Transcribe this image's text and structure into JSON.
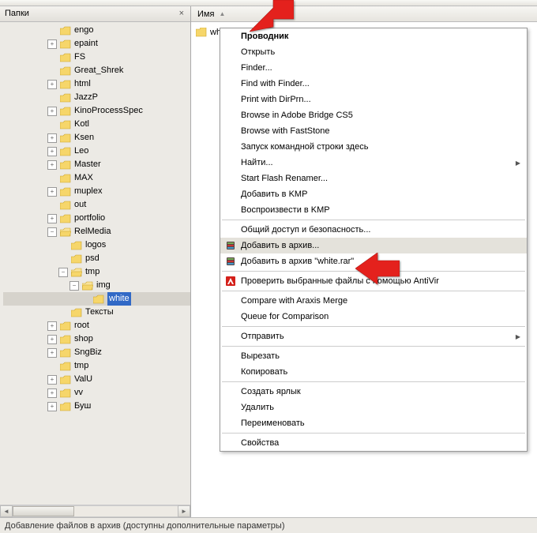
{
  "panel": {
    "title": "Папки"
  },
  "tree": {
    "items": [
      {
        "indent": 2,
        "expander": "",
        "label": "engo"
      },
      {
        "indent": 2,
        "expander": "+",
        "label": "epaint"
      },
      {
        "indent": 2,
        "expander": "",
        "label": "FS"
      },
      {
        "indent": 2,
        "expander": "",
        "label": "Great_Shrek"
      },
      {
        "indent": 2,
        "expander": "+",
        "label": "html"
      },
      {
        "indent": 2,
        "expander": "",
        "label": "JazzP"
      },
      {
        "indent": 2,
        "expander": "+",
        "label": "KinoProcessSpec"
      },
      {
        "indent": 2,
        "expander": "",
        "label": "Kotl"
      },
      {
        "indent": 2,
        "expander": "+",
        "label": "Ksen"
      },
      {
        "indent": 2,
        "expander": "+",
        "label": "Leo"
      },
      {
        "indent": 2,
        "expander": "+",
        "label": "Master"
      },
      {
        "indent": 2,
        "expander": "",
        "label": "MAX"
      },
      {
        "indent": 2,
        "expander": "+",
        "label": "muplex"
      },
      {
        "indent": 2,
        "expander": "",
        "label": "out"
      },
      {
        "indent": 2,
        "expander": "+",
        "label": "portfolio"
      },
      {
        "indent": 2,
        "expander": "-",
        "label": "RelMedia",
        "open": true
      },
      {
        "indent": 3,
        "expander": "",
        "label": "logos"
      },
      {
        "indent": 3,
        "expander": "",
        "label": "psd"
      },
      {
        "indent": 3,
        "expander": "-",
        "label": "tmp",
        "open": true
      },
      {
        "indent": 4,
        "expander": "-",
        "label": "img",
        "open": true
      },
      {
        "indent": 5,
        "expander": "",
        "label": "white",
        "selected": true
      },
      {
        "indent": 3,
        "expander": "",
        "label": "Тексты"
      },
      {
        "indent": 2,
        "expander": "+",
        "label": "root"
      },
      {
        "indent": 2,
        "expander": "+",
        "label": "shop"
      },
      {
        "indent": 2,
        "expander": "+",
        "label": "SngBiz"
      },
      {
        "indent": 2,
        "expander": "",
        "label": "tmp"
      },
      {
        "indent": 2,
        "expander": "+",
        "label": "ValU"
      },
      {
        "indent": 2,
        "expander": "+",
        "label": "vv"
      },
      {
        "indent": 2,
        "expander": "+",
        "label": "Буш"
      }
    ]
  },
  "list": {
    "column": "Имя",
    "file": "white"
  },
  "context_menu": [
    {
      "type": "item",
      "label": "Проводник",
      "bold": true
    },
    {
      "type": "item",
      "label": "Открыть"
    },
    {
      "type": "item",
      "label": "Finder..."
    },
    {
      "type": "item",
      "label": "Find with Finder..."
    },
    {
      "type": "item",
      "label": "Print with DirPrn..."
    },
    {
      "type": "item",
      "label": "Browse in Adobe Bridge CS5"
    },
    {
      "type": "item",
      "label": "Browse with FastStone"
    },
    {
      "type": "item",
      "label": "Запуск командной строки здесь"
    },
    {
      "type": "item",
      "label": "Найти...",
      "sub": true
    },
    {
      "type": "item",
      "label": "Start Flash Renamer..."
    },
    {
      "type": "item",
      "label": "Добавить в KMP"
    },
    {
      "type": "item",
      "label": "Воспроизвести в KMP"
    },
    {
      "type": "sep"
    },
    {
      "type": "item",
      "label": "Общий доступ и безопасность..."
    },
    {
      "type": "item",
      "label": "Добавить в архив...",
      "icon": "archive",
      "hl": true
    },
    {
      "type": "item",
      "label": "Добавить в архив \"white.rar\"",
      "icon": "archive"
    },
    {
      "type": "sep"
    },
    {
      "type": "item",
      "label": "Проверить выбранные файлы с помощью AntiVir",
      "icon": "antivir"
    },
    {
      "type": "sep"
    },
    {
      "type": "item",
      "label": "Compare with Araxis Merge"
    },
    {
      "type": "item",
      "label": "Queue for Comparison"
    },
    {
      "type": "sep"
    },
    {
      "type": "item",
      "label": "Отправить",
      "sub": true
    },
    {
      "type": "sep"
    },
    {
      "type": "item",
      "label": "Вырезать"
    },
    {
      "type": "item",
      "label": "Копировать"
    },
    {
      "type": "sep"
    },
    {
      "type": "item",
      "label": "Создать ярлык"
    },
    {
      "type": "item",
      "label": "Удалить"
    },
    {
      "type": "item",
      "label": "Переименовать"
    },
    {
      "type": "sep"
    },
    {
      "type": "item",
      "label": "Свойства"
    }
  ],
  "status": {
    "text": "Добавление файлов в архив (доступны дополнительные параметры)"
  }
}
